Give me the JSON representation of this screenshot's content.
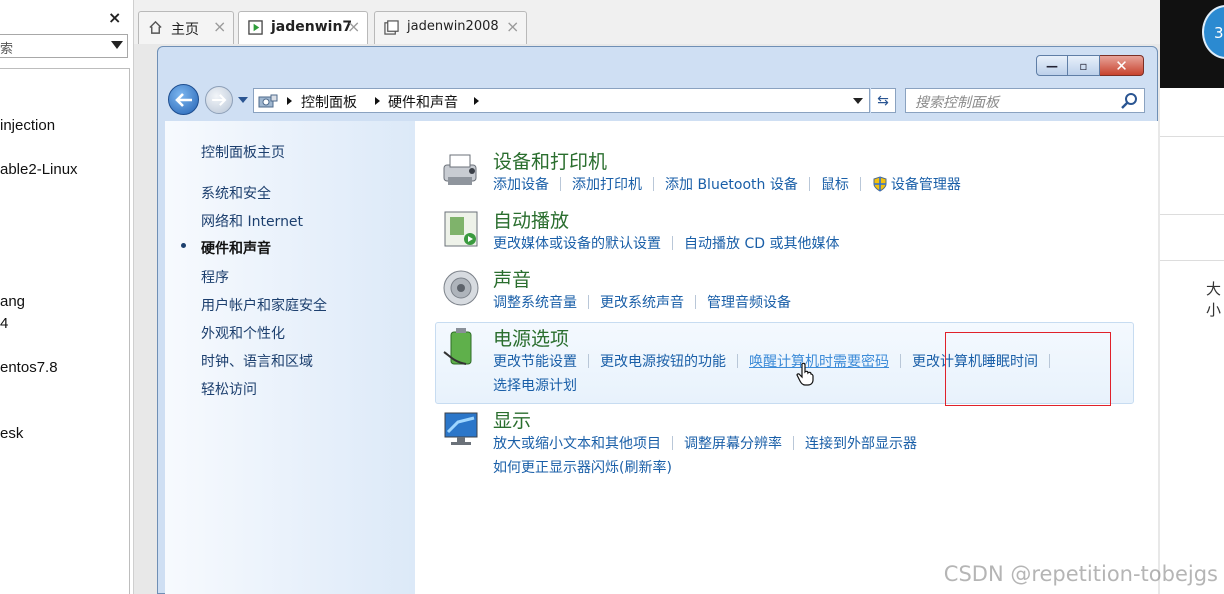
{
  "left_pane": {
    "close": "×",
    "search_fragment": "索",
    "items": [
      "injection",
      "able2-Linux",
      "ang",
      "4",
      "entos7.8",
      "esk"
    ]
  },
  "tabs": [
    {
      "label": "主页",
      "icon": "home-icon"
    },
    {
      "label": "jadenwin7",
      "icon": "vm-running-icon",
      "active": true
    },
    {
      "label": "jadenwin2008",
      "icon": "vm-icon"
    }
  ],
  "tab_close": "×",
  "window": {
    "controls": {
      "min": "—",
      "max": "▫",
      "close": "✕"
    },
    "breadcrumb": [
      "控制面板",
      "硬件和声音"
    ],
    "search_placeholder": "搜索控制面板"
  },
  "nav": {
    "home": "控制面板主页",
    "items": [
      "系统和安全",
      "网络和 Internet",
      "硬件和声音",
      "程序",
      "用户帐户和家庭安全",
      "外观和个性化",
      "时钟、语言和区域",
      "轻松访问"
    ],
    "current_index": 2
  },
  "categories": {
    "devices": {
      "title": "设备和打印机",
      "links": [
        "添加设备",
        "添加打印机",
        "添加 Bluetooth 设备",
        "鼠标",
        "设备管理器"
      ]
    },
    "autoplay": {
      "title": "自动播放",
      "links": [
        "更改媒体或设备的默认设置",
        "自动播放 CD 或其他媒体"
      ]
    },
    "sound": {
      "title": "声音",
      "links": [
        "调整系统音量",
        "更改系统声音",
        "管理音频设备"
      ]
    },
    "power": {
      "title": "电源选项",
      "links": [
        "更改节能设置",
        "更改电源按钮的功能",
        "唤醒计算机时需要密码",
        "更改计算机睡眠时间",
        "选择电源计划"
      ]
    },
    "display": {
      "title": "显示",
      "links": [
        "放大或缩小文本和其他项目",
        "调整屏幕分辨率",
        "连接到外部显示器",
        "如何更正显示器闪烁(刷新率)"
      ]
    }
  },
  "right_pane": {
    "avatar_text": "3",
    "text": "大小"
  },
  "watermark": "CSDN @repetition-tobejgs",
  "colors": {
    "highlight": "#e0212a",
    "link": "#1a5fa8",
    "category_title": "#2a6e2e"
  }
}
